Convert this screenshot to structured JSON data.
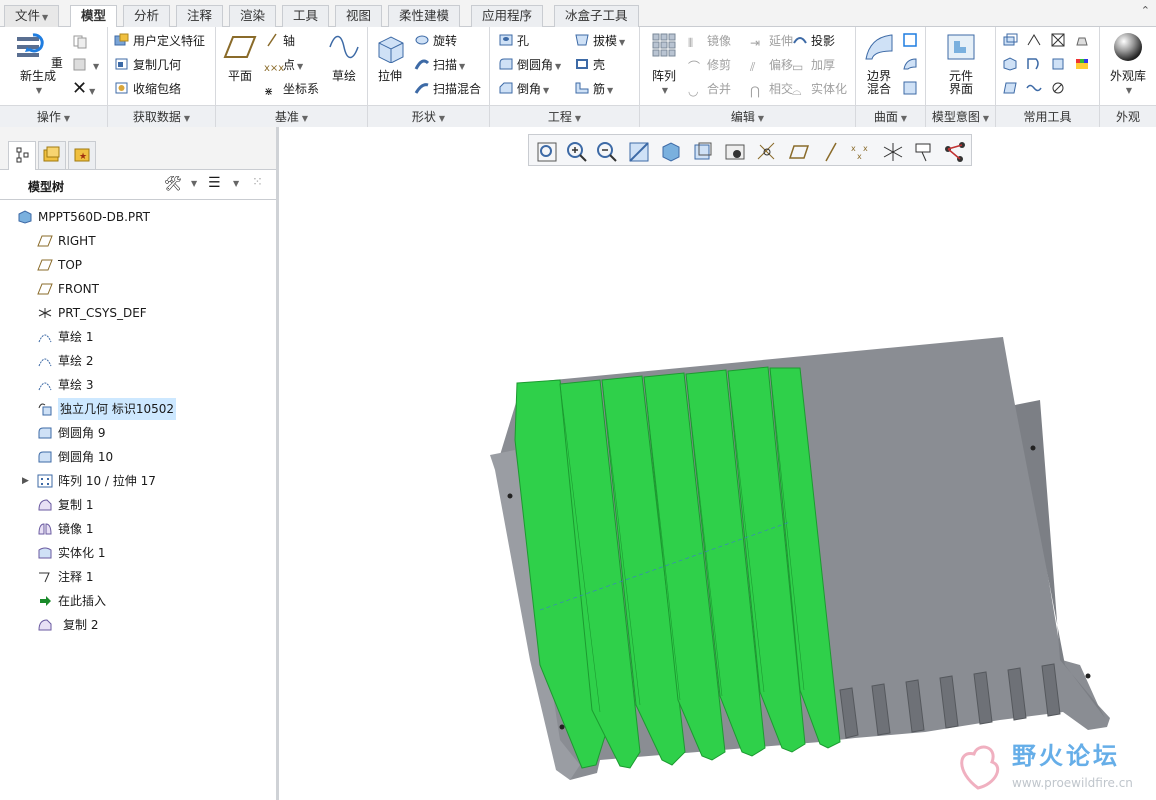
{
  "tabs": [
    {
      "label": "文件"
    },
    {
      "label": "模型"
    },
    {
      "label": "分析"
    },
    {
      "label": "注释"
    },
    {
      "label": "渲染"
    },
    {
      "label": "工具"
    },
    {
      "label": "视图"
    },
    {
      "label": "柔性建模"
    },
    {
      "label": "应用程序"
    },
    {
      "label": "冰盒子工具"
    }
  ],
  "ribbon": {
    "ops": {
      "regen": "重新生成",
      "group": "操作"
    },
    "getdata": {
      "udf": "用户定义特征",
      "copygeom": "复制几何",
      "shrinkwrap": "收缩包络",
      "group": "获取数据"
    },
    "datum": {
      "plane": "平面",
      "axis": "轴",
      "point": "点",
      "csys": "坐标系",
      "sketch": "草绘",
      "group": "基准"
    },
    "shape": {
      "extrude": "拉伸",
      "revolve": "旋转",
      "sweep": "扫描",
      "sweepblend": "扫描混合",
      "group": "形状"
    },
    "eng": {
      "hole": "孔",
      "draft": "拔模",
      "round": "倒圆角",
      "shell": "壳",
      "chamfer": "倒角",
      "rib": "筋",
      "group": "工程"
    },
    "edit": {
      "pattern": "阵列",
      "mirror": "镜像",
      "extend": "延伸",
      "project": "投影",
      "trim": "修剪",
      "offset": "偏移",
      "thicken": "加厚",
      "merge": "合并",
      "intersect": "相交",
      "solidify": "实体化",
      "group": "编辑"
    },
    "surface": {
      "boundary1": "边界",
      "boundary2": "混合",
      "group": "曲面"
    },
    "intent": {
      "elem1": "元件",
      "elem2": "界面",
      "group": "模型意图"
    },
    "common": {
      "group": "常用工具"
    },
    "appearance": {
      "lib": "外观库",
      "group": "外观"
    }
  },
  "tree": {
    "title": "模型树",
    "items": [
      {
        "label": "MPPT560D-DB.PRT"
      },
      {
        "label": "RIGHT"
      },
      {
        "label": "TOP"
      },
      {
        "label": "FRONT"
      },
      {
        "label": "PRT_CSYS_DEF"
      },
      {
        "label": "草绘 1"
      },
      {
        "label": "草绘 2"
      },
      {
        "label": "草绘 3"
      },
      {
        "label": "独立几何 标识10502"
      },
      {
        "label": "倒圆角 9"
      },
      {
        "label": "倒圆角 10"
      },
      {
        "label": "阵列 10 / 拉伸 17"
      },
      {
        "label": "复制 1"
      },
      {
        "label": "镜像 1"
      },
      {
        "label": "实体化 1"
      },
      {
        "label": "注释 1"
      },
      {
        "label": "在此插入"
      },
      {
        "label": "复制 2"
      }
    ]
  },
  "watermark": {
    "title": "野火论坛",
    "url": "www.proewildfire.cn"
  },
  "colors": {
    "accent_green": "#2fd04a",
    "model_gray": "#8a8d93",
    "tab_border": "#c9ccd1"
  }
}
